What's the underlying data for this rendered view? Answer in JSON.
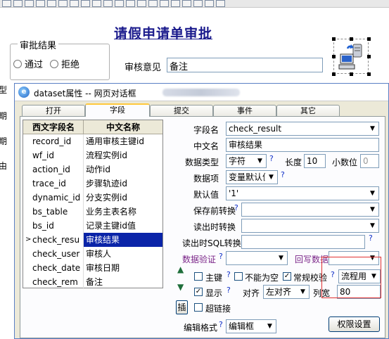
{
  "toolbar_icons": [
    "dw-icon",
    "image-icon",
    "list-icon",
    "table-icon",
    "frame-icon",
    "gear-icon",
    "checkbox-icon",
    "radio-icon",
    "combobox-icon",
    "textbox-icon",
    "grid-icon",
    "tree-icon",
    "pdf-icon",
    "settings-icon",
    "textarea-icon",
    "panel-icon",
    "dataset-icon",
    "button-icon",
    "link-icon",
    "export-icon"
  ],
  "page": {
    "title": "请假申请单审批",
    "approval": {
      "legend": "审批结果",
      "option_pass": "通过",
      "option_reject": "拒绝"
    },
    "review_label": "审核意见",
    "review_value": "备注",
    "side_labels": [
      "型",
      "期",
      "期",
      "由"
    ]
  },
  "dialog": {
    "title": "dataset属性 -- 网页对话框",
    "tabs": [
      "打开",
      "字段",
      "提交",
      "事件",
      "其它"
    ],
    "active_tab": 1,
    "grid": {
      "headers": [
        "西文字段名",
        "中文名称"
      ],
      "rows": [
        {
          "en": "record_id",
          "cn": "通用审核主键id"
        },
        {
          "en": "wf_id",
          "cn": "流程实例id"
        },
        {
          "en": "action_id",
          "cn": "动作id"
        },
        {
          "en": "trace_id",
          "cn": "步骤轨迹id"
        },
        {
          "en": "dynamic_id",
          "cn": "分支实例id"
        },
        {
          "en": "bs_table",
          "cn": "业务主表名称"
        },
        {
          "en": "bs_id",
          "cn": "记录主键id值"
        },
        {
          "en": "check_resu",
          "cn": "审核结果",
          "selected": true
        },
        {
          "en": "check_user",
          "cn": "审核人"
        },
        {
          "en": "check_date",
          "cn": "审核日期"
        },
        {
          "en": "check_rem",
          "cn": "备注"
        }
      ],
      "selected_marker": ">"
    },
    "form": {
      "field_name_label": "字段名",
      "field_name_value": "check_result",
      "cn_name_label": "中文名",
      "cn_name_value": "审核结果",
      "data_type_label": "数据类型",
      "data_type_value": "字符",
      "length_label": "长度",
      "length_value": "10",
      "decimal_label": "小数位",
      "decimal_value": "0",
      "data_item_label": "数据项",
      "data_item_value": "变量默认值",
      "default_label": "默认值",
      "default_value": "'1'",
      "pre_save_label": "保存前转换",
      "on_read_label": "读出时转换",
      "sql_read_label": "读出时SQL转换",
      "validate_label": "数据验证",
      "writeback_label": "回写数据",
      "primary_key_label": "主键",
      "not_null_label": "不能为空",
      "regular_check_label": "常规校验",
      "process_use_value": "流程用",
      "show_label": "显示",
      "align_label": "对齐",
      "align_value": "左对齐",
      "col_width_label": "列宽",
      "col_width_value": "80",
      "insert_label": "插",
      "hyperlink_label": "超链接",
      "edit_format_label": "编辑格式",
      "edit_format_value": "编辑框",
      "permission_button": "权限设置",
      "question_mark": "?"
    }
  },
  "colors": {
    "title_blue": "#1a1a8c",
    "selection": "#0a24a8",
    "purple_label": "#7a2488",
    "highlight_red": "#e03030"
  }
}
